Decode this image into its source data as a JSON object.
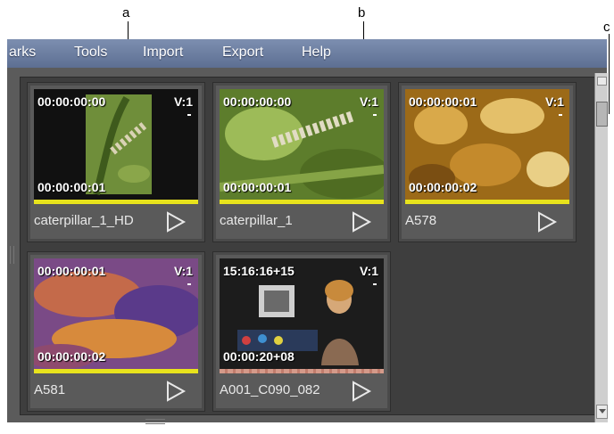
{
  "callouts": {
    "a": "a",
    "b": "b",
    "c": "c"
  },
  "menu": [
    "arks",
    "Tools",
    "Import",
    "Export",
    "Help"
  ],
  "clips": [
    {
      "tc_in": "00:00:00:00",
      "tc_out": "00:00:00:01",
      "track": "V:1",
      "name": "caterpillar_1_HD",
      "status_color": "#e8e31c"
    },
    {
      "tc_in": "00:00:00:00",
      "tc_out": "00:00:00:01",
      "track": "V:1",
      "name": "caterpillar_1",
      "status_color": "#e8e31c"
    },
    {
      "tc_in": "00:00:00:01",
      "tc_out": "00:00:00:02",
      "track": "V:1",
      "name": "A578",
      "status_color": "#e8e31c"
    },
    {
      "tc_in": "00:00:00:01",
      "tc_out": "00:00:00:02",
      "track": "V:1",
      "name": "A581",
      "status_color": "#e8e31c"
    },
    {
      "tc_in": "15:16:16+15",
      "tc_out": "00:00:20+08",
      "track": "V:1",
      "name": "A001_C090_082",
      "status_color": "#d49a8a"
    }
  ],
  "icons": {
    "play": "play-triangle-icon"
  }
}
